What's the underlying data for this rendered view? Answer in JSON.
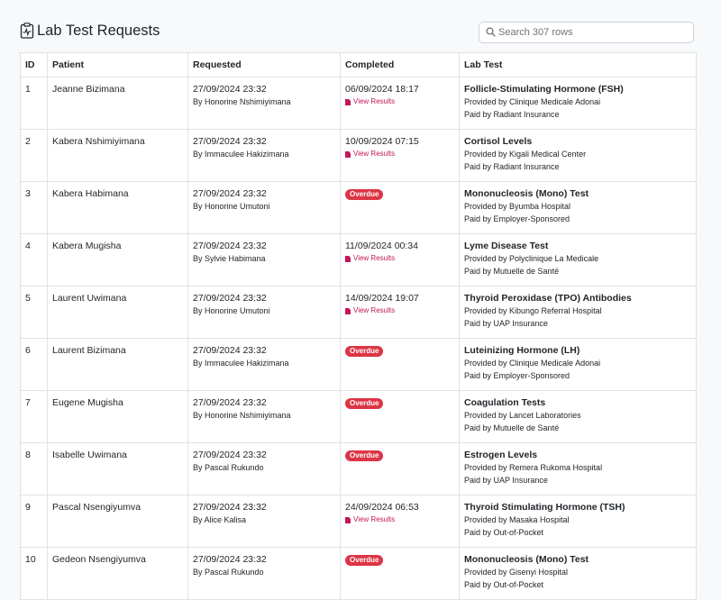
{
  "page": {
    "title": "Lab Test Requests",
    "title_icon": "clipboard-pulse-icon",
    "search_placeholder": "Search 307 rows",
    "accent": "#dc3545",
    "link_color": "#c2185b"
  },
  "columns": [
    "ID",
    "Patient",
    "Requested",
    "Completed",
    "Lab Test"
  ],
  "rows": [
    {
      "id": "1",
      "patient": "Jeanne Bizimana",
      "req_date": "27/09/2024 23:32",
      "req_by": "By Honorine Nshimiyimana",
      "completed": "06/09/2024 18:17",
      "status": "done",
      "view": "View Results",
      "test": "Follicle-Stimulating Hormone (FSH)",
      "provider": "Provided by Clinique Medicale Adonai",
      "payer": "Paid by Radiant Insurance"
    },
    {
      "id": "2",
      "patient": "Kabera Nshimiyimana",
      "req_date": "27/09/2024 23:32",
      "req_by": "By Immaculee Hakizimana",
      "completed": "10/09/2024 07:15",
      "status": "done",
      "view": "View Results",
      "test": "Cortisol Levels",
      "provider": "Provided by Kigali Medical Center",
      "payer": "Paid by Radiant Insurance"
    },
    {
      "id": "3",
      "patient": "Kabera Habimana",
      "req_date": "27/09/2024 23:32",
      "req_by": "By Honorine Umutoni",
      "completed": "",
      "status": "overdue",
      "badge": "Overdue",
      "test": "Mononucleosis (Mono) Test",
      "provider": "Provided by Byumba Hospital",
      "payer": "Paid by Employer-Sponsored"
    },
    {
      "id": "4",
      "patient": "Kabera Mugisha",
      "req_date": "27/09/2024 23:32",
      "req_by": "By Sylvie Habimana",
      "completed": "11/09/2024 00:34",
      "status": "done",
      "view": "View Results",
      "test": "Lyme Disease Test",
      "provider": "Provided by Polyclinique La Medicale",
      "payer": "Paid by Mutuelle de Santé"
    },
    {
      "id": "5",
      "patient": "Laurent Uwimana",
      "req_date": "27/09/2024 23:32",
      "req_by": "By Honorine Umutoni",
      "completed": "14/09/2024 19:07",
      "status": "done",
      "view": "View Results",
      "test": "Thyroid Peroxidase (TPO) Antibodies",
      "provider": "Provided by Kibungo Referral Hospital",
      "payer": "Paid by UAP Insurance"
    },
    {
      "id": "6",
      "patient": "Laurent Bizimana",
      "req_date": "27/09/2024 23:32",
      "req_by": "By Immaculee Hakizimana",
      "completed": "",
      "status": "overdue",
      "badge": "Overdue",
      "test": "Luteinizing Hormone (LH)",
      "provider": "Provided by Clinique Medicale Adonai",
      "payer": "Paid by Employer-Sponsored"
    },
    {
      "id": "7",
      "patient": "Eugene Mugisha",
      "req_date": "27/09/2024 23:32",
      "req_by": "By Honorine Nshimiyimana",
      "completed": "",
      "status": "overdue",
      "badge": "Overdue",
      "test": "Coagulation Tests",
      "provider": "Provided by Lancet Laboratories",
      "payer": "Paid by Mutuelle de Santé"
    },
    {
      "id": "8",
      "patient": "Isabelle Uwimana",
      "req_date": "27/09/2024 23:32",
      "req_by": "By Pascal Rukundo",
      "completed": "",
      "status": "overdue",
      "badge": "Overdue",
      "test": "Estrogen Levels",
      "provider": "Provided by Remera Rukoma Hospital",
      "payer": "Paid by UAP Insurance"
    },
    {
      "id": "9",
      "patient": "Pascal Nsengiyumva",
      "req_date": "27/09/2024 23:32",
      "req_by": "By Alice Kalisa",
      "completed": "24/09/2024 06:53",
      "status": "done",
      "view": "View Results",
      "test": "Thyroid Stimulating Hormone (TSH)",
      "provider": "Provided by Masaka Hospital",
      "payer": "Paid by Out-of-Pocket"
    },
    {
      "id": "10",
      "patient": "Gedeon Nsengiyumva",
      "req_date": "27/09/2024 23:32",
      "req_by": "By Pascal Rukundo",
      "completed": "",
      "status": "overdue",
      "badge": "Overdue",
      "test": "Mononucleosis (Mono) Test",
      "provider": "Provided by Gisenyi Hospital",
      "payer": "Paid by Out-of-Pocket"
    }
  ]
}
